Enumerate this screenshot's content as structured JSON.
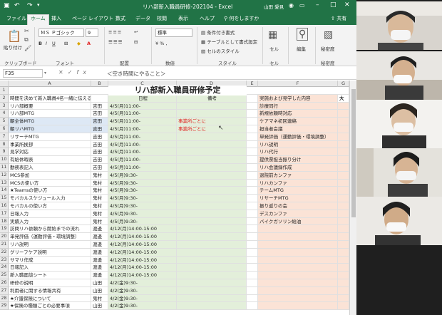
{
  "window": {
    "title": "リハ部新入職員研修-202104 - Excel",
    "user": "山田 愛見"
  },
  "ribbon": {
    "tabs": [
      "ファイル",
      "ホーム",
      "挿入",
      "ページ レイアウト",
      "数式",
      "データ",
      "校閲",
      "表示",
      "ヘルプ",
      "何をしますか",
      "共有"
    ],
    "active_tab": "ホーム",
    "font_name": "ＭＳ Ｐゴシック",
    "font_size": "9",
    "number_format": "標準",
    "paste_label": "貼り付け",
    "cond_format": "条件付き書式",
    "table_format": "テーブルとして書式設定",
    "cell_style": "セルのスタイル",
    "cell_label": "セル",
    "edit_label": "編集",
    "groups": [
      "クリップボード",
      "フォント",
      "配置",
      "数値",
      "スタイル",
      "セル",
      "秘密度"
    ],
    "sensitivity_label": "秘密度"
  },
  "formula_bar": {
    "name_box": "F35",
    "value": "＜空き時間にやること＞"
  },
  "sheet": {
    "columns": [
      "A",
      "B",
      "C",
      "D",
      "E",
      "F",
      "G"
    ],
    "title": "リハ部新入職員研修予定",
    "headers": {
      "a": "時間を決めて新入職員4名一緒に伝える内容",
      "c": "日程",
      "d": "備考",
      "f": "実施および見学した内容",
      "g": "大"
    },
    "rows": [
      {
        "n": "1",
        "a": "",
        "b": "",
        "c": "",
        "d": "",
        "f": ""
      },
      {
        "n": "2",
        "a": "",
        "b": "",
        "c": "",
        "d": "",
        "f": ""
      },
      {
        "n": "3",
        "a": "リハ部概要",
        "b": "吉田",
        "c": "4/5(月)11:00-",
        "d": "",
        "f": "診療同行"
      },
      {
        "n": "4",
        "a": "リハ部MTG",
        "b": "吉田",
        "c": "4/5(月)11:00-",
        "d": "",
        "f": "新規依頼時対応"
      },
      {
        "n": "5",
        "a": "朝全体MTG",
        "b": "吉田",
        "c": "4/5(月)11:00-",
        "d": "事業所ごとに",
        "f": "ケアマネ初回連絡"
      },
      {
        "n": "6",
        "a": "朝リハMTG",
        "b": "吉田",
        "c": "4/5(月)11:00-",
        "d": "事業所ごとに",
        "f": "担当者会議"
      },
      {
        "n": "7",
        "a": "リサーチMTG",
        "b": "吉田",
        "c": "4/5(月)11:00-",
        "d": "",
        "f": "単発評価（運動評価・環境調整）"
      },
      {
        "n": "8",
        "a": "事業所挨拶",
        "b": "吉田",
        "c": "4/5(月)11:00-",
        "d": "",
        "f": "リハ説明"
      },
      {
        "n": "9",
        "a": "見学対応",
        "b": "吉田",
        "c": "4/5(月)11:00-",
        "d": "",
        "f": "リハ代行"
      },
      {
        "n": "10",
        "a": "有給休暇表",
        "b": "吉田",
        "c": "4/5(月)11:00-",
        "d": "",
        "f": "提供票担当振り分け"
      },
      {
        "n": "11",
        "a": "勤務表記入",
        "b": "吉田",
        "c": "4/5(月)11:00-",
        "d": "",
        "f": "リハ会議録作成"
      },
      {
        "n": "12",
        "a": "MCS参加",
        "b": "鬼村",
        "c": "4/5(月)9:30-",
        "d": "",
        "f": "退院前カンファ"
      },
      {
        "n": "13",
        "a": "MCSの使い方",
        "b": "鬼村",
        "c": "4/5(月)9:30-",
        "d": "",
        "f": "リハカンファ"
      },
      {
        "n": "14",
        "a": "★Teamsの使い方",
        "b": "鬼村",
        "c": "4/5(月)9:30-",
        "d": "",
        "f": "チームMTG"
      },
      {
        "n": "15",
        "a": "モバカルスケジュール入力",
        "b": "鬼村",
        "c": "4/5(月)9:30-",
        "d": "",
        "f": "リサーチMTG"
      },
      {
        "n": "16",
        "a": "モバカルの使い方",
        "b": "鬼村",
        "c": "4/5(月)9:30-",
        "d": "",
        "f": "振り返りの会"
      },
      {
        "n": "17",
        "a": "日報入力",
        "b": "鬼村",
        "c": "4/5(月)9:30-",
        "d": "",
        "f": "デスカンファ"
      },
      {
        "n": "18",
        "a": "実績入力",
        "b": "鬼村",
        "c": "4/5(月)9:30-",
        "d": "",
        "f": "バイクガソリン給油"
      },
      {
        "n": "19",
        "a": "訪問リハ依頼から開始までの流れ",
        "b": "渡邊",
        "c": "4/12(月)14:00-15:00",
        "d": "",
        "f": ""
      },
      {
        "n": "20",
        "a": "単発評価（運動評価・環境調整）",
        "b": "渡邊",
        "c": "4/12(月)14:00-15:00",
        "d": "",
        "f": ""
      },
      {
        "n": "21",
        "a": "リハ説明",
        "b": "渡邊",
        "c": "4/12(月)14:00-15:00",
        "d": "",
        "f": ""
      },
      {
        "n": "22",
        "a": "グリーフケア説明",
        "b": "渡邊",
        "c": "4/12(月)14:00-15:00",
        "d": "",
        "f": ""
      },
      {
        "n": "23",
        "a": "サマリ作成",
        "b": "渡邊",
        "c": "4/12(月)14:00-15:00",
        "d": "",
        "f": ""
      },
      {
        "n": "24",
        "a": "日報記入",
        "b": "渡邊",
        "c": "4/12(月)14:00-15:00",
        "d": "",
        "f": ""
      },
      {
        "n": "25",
        "a": "新入職面談シート",
        "b": "渡邊",
        "c": "4/12(月)14:00-15:00",
        "d": "",
        "f": ""
      },
      {
        "n": "26",
        "a": "研修の説明",
        "b": "山田",
        "c": "4/2(金)9:30-",
        "d": "",
        "f": ""
      },
      {
        "n": "27",
        "a": "利用者に関する情報共有",
        "b": "山田",
        "c": "4/2(金)9:30-",
        "d": "",
        "f": ""
      },
      {
        "n": "28",
        "a": "★介護保険について",
        "b": "鬼村",
        "c": "4/2(金)9:30-",
        "d": "",
        "f": ""
      },
      {
        "n": "29",
        "a": "★保険の種類ごとの必要事項",
        "b": "山田",
        "c": "4/2(金)9:30-",
        "d": "",
        "f": ""
      }
    ]
  },
  "colors": {
    "excel_green": "#217346",
    "date_fill": "#e3efda",
    "list_fill": "#fbe3d6",
    "highlight_row": "#dde8f5",
    "remark_red": "#e02020"
  }
}
